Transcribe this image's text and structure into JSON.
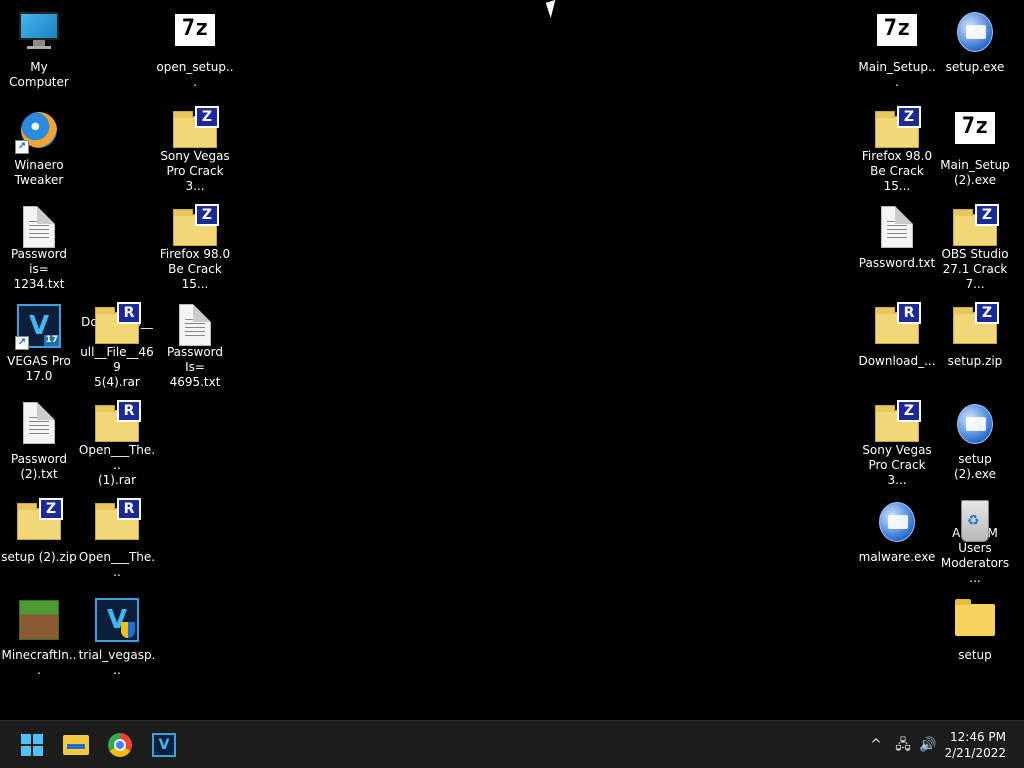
{
  "desktop": {
    "icons": [
      {
        "label": "My Computer",
        "kind": "computer",
        "icon": "computer-icon"
      },
      {
        "label": "Winaero\nTweaker",
        "kind": "globe",
        "icon": "winaero-tweaker-icon",
        "shortcut": true
      },
      {
        "label": "Password is=\n1234.txt",
        "kind": "doc",
        "icon": "text-file-icon"
      },
      {
        "label": "VEGAS Pro\n17.0",
        "kind": "vegas",
        "icon": "vegas-pro-icon",
        "shortcut": true,
        "version": "17"
      },
      {
        "label": "Password\n(2).txt",
        "kind": "doc",
        "icon": "text-file-icon"
      },
      {
        "label": "setup (2).zip",
        "kind": "zip",
        "icon": "zip-archive-icon"
      },
      {
        "label": "MinecraftIn...",
        "kind": "mc",
        "icon": "minecraft-installer-icon"
      },
      {
        "label": "Download__F\null__File__469\n5(4).rar",
        "kind": "rar",
        "icon": "rar-archive-icon"
      },
      {
        "label": "Open___The...\n(1).rar",
        "kind": "rar",
        "icon": "rar-archive-icon"
      },
      {
        "label": "Open___The...",
        "kind": "rar",
        "icon": "rar-archive-icon"
      },
      {
        "label": "trial_vegasp...",
        "kind": "vegas-shield",
        "icon": "vegas-installer-icon"
      },
      {
        "label": "open_setup...",
        "kind": "7z",
        "icon": "7zip-icon"
      },
      {
        "label": "Sony Vegas\nPro  Crack 3...",
        "kind": "zip",
        "icon": "zip-archive-icon"
      },
      {
        "label": "Firefox 98.0\nBe Crack 15...",
        "kind": "zip",
        "icon": "zip-archive-icon"
      },
      {
        "label": "Password Is=\n4695.txt",
        "kind": "doc",
        "icon": "text-file-icon"
      },
      {
        "label": "Main_Setup...",
        "kind": "7z",
        "icon": "7zip-icon"
      },
      {
        "label": "Firefox 98.0\nBe Crack 15...",
        "kind": "zip",
        "icon": "zip-archive-icon"
      },
      {
        "label": "Password.txt",
        "kind": "doc",
        "icon": "text-file-icon"
      },
      {
        "label": "Download_...",
        "kind": "rar",
        "icon": "rar-archive-icon"
      },
      {
        "label": "Sony Vegas\nPro  Crack 3...",
        "kind": "zip",
        "icon": "zip-archive-icon"
      },
      {
        "label": "malware.exe",
        "kind": "exe",
        "icon": "executable-icon"
      },
      {
        "label": "setup.exe",
        "kind": "exe",
        "icon": "executable-icon"
      },
      {
        "label": "Main_Setup\n(2).exe",
        "kind": "7z",
        "icon": "7zip-icon"
      },
      {
        "label": "OBS Studio\n27.1 Crack 7...",
        "kind": "zip",
        "icon": "zip-archive-icon"
      },
      {
        "label": "setup.zip",
        "kind": "zip",
        "icon": "zip-archive-icon"
      },
      {
        "label": "setup (2).exe",
        "kind": "exe",
        "icon": "executable-icon"
      },
      {
        "label": "All CVM Users\nModerators ...",
        "kind": "bin",
        "icon": "recycle-bin-icon"
      },
      {
        "label": "setup",
        "kind": "folder",
        "icon": "folder-icon"
      }
    ]
  },
  "badges": {
    "zip": "Z",
    "rar": "R",
    "sevenzip": "7z"
  },
  "taskbar": {
    "apps": [
      {
        "name": "start-button",
        "icon": "windows-logo-icon"
      },
      {
        "name": "file-explorer-button",
        "icon": "file-explorer-icon"
      },
      {
        "name": "chrome-button",
        "icon": "chrome-icon"
      },
      {
        "name": "vegas-taskbar-button",
        "icon": "vegas-pro-icon",
        "glyph": "V"
      }
    ],
    "tray": {
      "chevron": "^",
      "network": "🖧",
      "volume": "🔊"
    },
    "clock": {
      "time": "12:46 PM",
      "date": "2/21/2022"
    }
  }
}
